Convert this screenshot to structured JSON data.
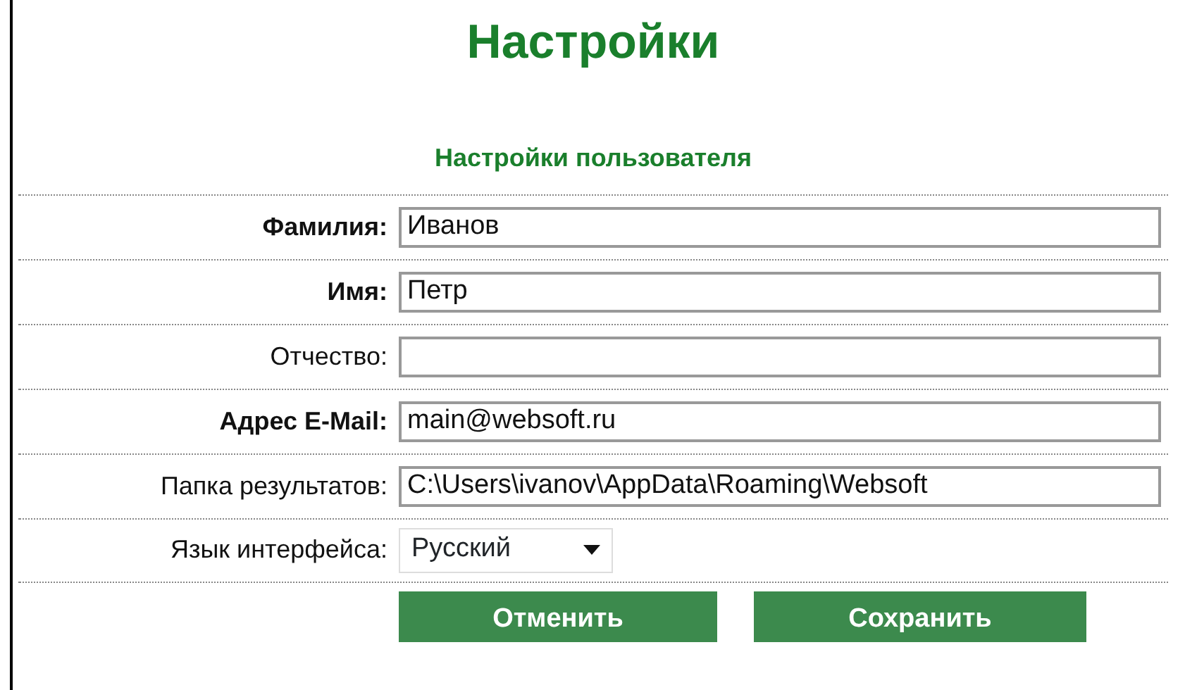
{
  "title": "Настройки",
  "subtitle": "Настройки пользователя",
  "fields": [
    {
      "kind": "text",
      "label": "Фамилия:",
      "required": true,
      "value": "Иванов"
    },
    {
      "kind": "text",
      "label": "Имя:",
      "required": true,
      "value": "Петр"
    },
    {
      "kind": "text",
      "label": "Отчество:",
      "required": false
    },
    {
      "kind": "text",
      "label": "Адрес E-Mail:",
      "required": true,
      "value": "main@websoft.ru"
    },
    {
      "kind": "text",
      "label": "Папка результатов:",
      "required": false,
      "value": "C:\\Users\\ivanov\\AppData\\Roaming\\Websoft"
    },
    {
      "kind": "select",
      "label": "Язык интерфейса:",
      "required": false,
      "value": "Русский"
    }
  ],
  "buttons": [
    "Отменить",
    "Сохранить"
  ]
}
